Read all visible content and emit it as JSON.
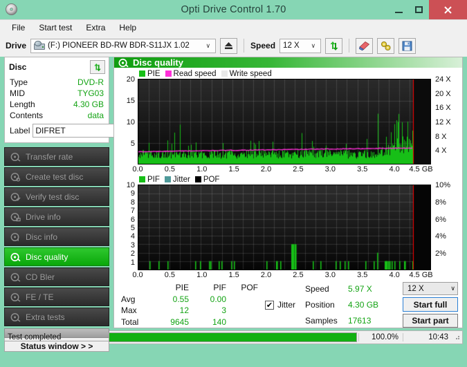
{
  "window": {
    "title": "Opti Drive Control 1.70",
    "app_icon": "disc-icon",
    "minimize": "–",
    "maximize": "□",
    "close": "✕"
  },
  "menu": [
    {
      "label": "File"
    },
    {
      "label": "Start test"
    },
    {
      "label": "Extra"
    },
    {
      "label": "Help"
    }
  ],
  "toolbar": {
    "drive_label": "Drive",
    "drive_value": "(F:)  PIONEER BD-RW  BDR-S11JX 1.02",
    "eject_icon": "eject-icon",
    "speed_label": "Speed",
    "speed_value": "12 X",
    "refresh_icon": "refresh-icon",
    "erase_icon": "eraser-icon",
    "tools_icon": "gear-icon",
    "save_icon": "save-icon",
    "dropdown_arrow": "∨"
  },
  "disc_panel": {
    "title": "Disc",
    "refresh_icon": "refresh-icon",
    "rows": [
      {
        "key": "Type",
        "value": "DVD-R"
      },
      {
        "key": "MID",
        "value": "TYG03"
      },
      {
        "key": "Length",
        "value": "4.30 GB"
      },
      {
        "key": "Contents",
        "value": "data"
      }
    ],
    "label_key": "Label",
    "label_value": "DIFRET",
    "label_placeholder": "",
    "disc_button_icon": "cd-icon"
  },
  "nav": {
    "items": [
      {
        "label": "Transfer rate",
        "icon": "disc-test-icon",
        "active": false
      },
      {
        "label": "Create test disc",
        "icon": "disc-burn-icon",
        "active": false
      },
      {
        "label": "Verify test disc",
        "icon": "disc-verify-icon",
        "active": false
      },
      {
        "label": "Drive info",
        "icon": "disc-drive-icon",
        "active": false
      },
      {
        "label": "Disc info",
        "icon": "disc-info-icon",
        "active": false
      },
      {
        "label": "Disc quality",
        "icon": "disc-quality-icon",
        "active": true
      },
      {
        "label": "CD Bler",
        "icon": "disc-bler-icon",
        "active": false
      },
      {
        "label": "FE / TE",
        "icon": "disc-fete-icon",
        "active": false
      },
      {
        "label": "Extra tests",
        "icon": "disc-extra-icon",
        "active": false
      }
    ],
    "status_window_label": "Status window > >"
  },
  "panel": {
    "header": "Disc quality",
    "header_icon": "disc-quality-icon"
  },
  "chart_data": [
    {
      "type": "bar",
      "id": "pie-chart",
      "title": "",
      "legend": [
        {
          "label": "PIE",
          "color": "#17bf17"
        },
        {
          "label": "Read speed",
          "color": "#ff2fd8"
        },
        {
          "label": "Write speed",
          "color": "#e8e8e8"
        }
      ],
      "legend_position": "top-left",
      "xlabel": "GB",
      "ylabel": "",
      "xlim": [
        0.0,
        4.57
      ],
      "ylim": [
        0,
        20
      ],
      "xticks": [
        "0.0",
        "0.5",
        "1.0",
        "1.5",
        "2.0",
        "2.5",
        "3.0",
        "3.5",
        "4.0",
        "4.5 GB"
      ],
      "xtick_values": [
        0.0,
        0.5,
        1.0,
        1.5,
        2.0,
        2.5,
        3.0,
        3.5,
        4.0,
        4.5
      ],
      "yticks": [
        "5",
        "10",
        "15",
        "20"
      ],
      "ytick_values": [
        5,
        10,
        15,
        20
      ],
      "y2lim": [
        0,
        24
      ],
      "y2ticks": [
        "4 X",
        "8 X",
        "12 X",
        "16 X",
        "20 X",
        "24 X"
      ],
      "y2tick_values": [
        4,
        8,
        12,
        16,
        20,
        24
      ],
      "grid": true,
      "marker_line": {
        "x": 4.3,
        "color": "#ff0000"
      },
      "series": [
        {
          "name": "PIE",
          "color": "#17bf17",
          "type": "bar",
          "baseline": 2.2,
          "avg": 0.55,
          "max": 12,
          "total": 9645
        },
        {
          "name": "Read speed",
          "color": "#ff2fd8",
          "type": "line",
          "start_value": 3.4,
          "end_value": 4.5,
          "axis": "right"
        }
      ]
    },
    {
      "type": "bar",
      "id": "pif-chart",
      "title": "",
      "legend": [
        {
          "label": "PIF",
          "color": "#17bf17"
        },
        {
          "label": "Jitter",
          "color": "#4f9a9a"
        },
        {
          "label": "POF",
          "color": "#000000"
        }
      ],
      "legend_position": "top-left",
      "xlabel": "GB",
      "ylabel": "",
      "xlim": [
        0.0,
        4.57
      ],
      "ylim": [
        0,
        10
      ],
      "xticks": [
        "0.0",
        "0.5",
        "1.0",
        "1.5",
        "2.0",
        "2.5",
        "3.0",
        "3.5",
        "4.0",
        "4.5 GB"
      ],
      "xtick_values": [
        0.0,
        0.5,
        1.0,
        1.5,
        2.0,
        2.5,
        3.0,
        3.5,
        4.0,
        4.5
      ],
      "yticks": [
        "1",
        "2",
        "3",
        "4",
        "5",
        "6",
        "7",
        "8",
        "9",
        "10"
      ],
      "ytick_values": [
        1,
        2,
        3,
        4,
        5,
        6,
        7,
        8,
        9,
        10
      ],
      "y2lim": [
        0,
        10
      ],
      "y2ticks": [
        "2%",
        "4%",
        "6%",
        "8%",
        "10%"
      ],
      "y2tick_values": [
        2,
        4,
        6,
        8,
        10
      ],
      "grid": true,
      "marker_line": {
        "x": 4.3,
        "color": "#ff0000"
      },
      "series": [
        {
          "name": "PIF",
          "color": "#17bf17",
          "type": "bar",
          "avg": 0.0,
          "max": 3,
          "total": 140
        }
      ]
    }
  ],
  "stats": {
    "columns": [
      "PIE",
      "PIF",
      "POF"
    ],
    "rows": [
      {
        "label": "Avg",
        "pie": "0.55",
        "pif": "0.00",
        "pof": ""
      },
      {
        "label": "Max",
        "pie": "12",
        "pif": "3",
        "pof": ""
      },
      {
        "label": "Total",
        "pie": "9645",
        "pif": "140",
        "pof": ""
      }
    ],
    "jitter_label": "Jitter",
    "jitter_checked": "✔",
    "speed_label": "Speed",
    "speed_value": "5.97 X",
    "position_label": "Position",
    "position_value": "4.30 GB",
    "samples_label": "Samples",
    "samples_value": "17613",
    "test_speed_value": "12 X",
    "dropdown_arrow": "∨",
    "start_full_label": "Start full",
    "start_part_label": "Start part"
  },
  "statusbar": {
    "message": "Test completed",
    "progress_percent": "100.0%",
    "progress_value": 100,
    "time": "10:43"
  },
  "colors": {
    "accent_green": "#13a313",
    "chart_green": "#17bf17",
    "read_speed": "#ff2fd8",
    "marker_red": "#ff0000",
    "window_chrome": "#86d6b4",
    "close_red": "#cc5055"
  }
}
